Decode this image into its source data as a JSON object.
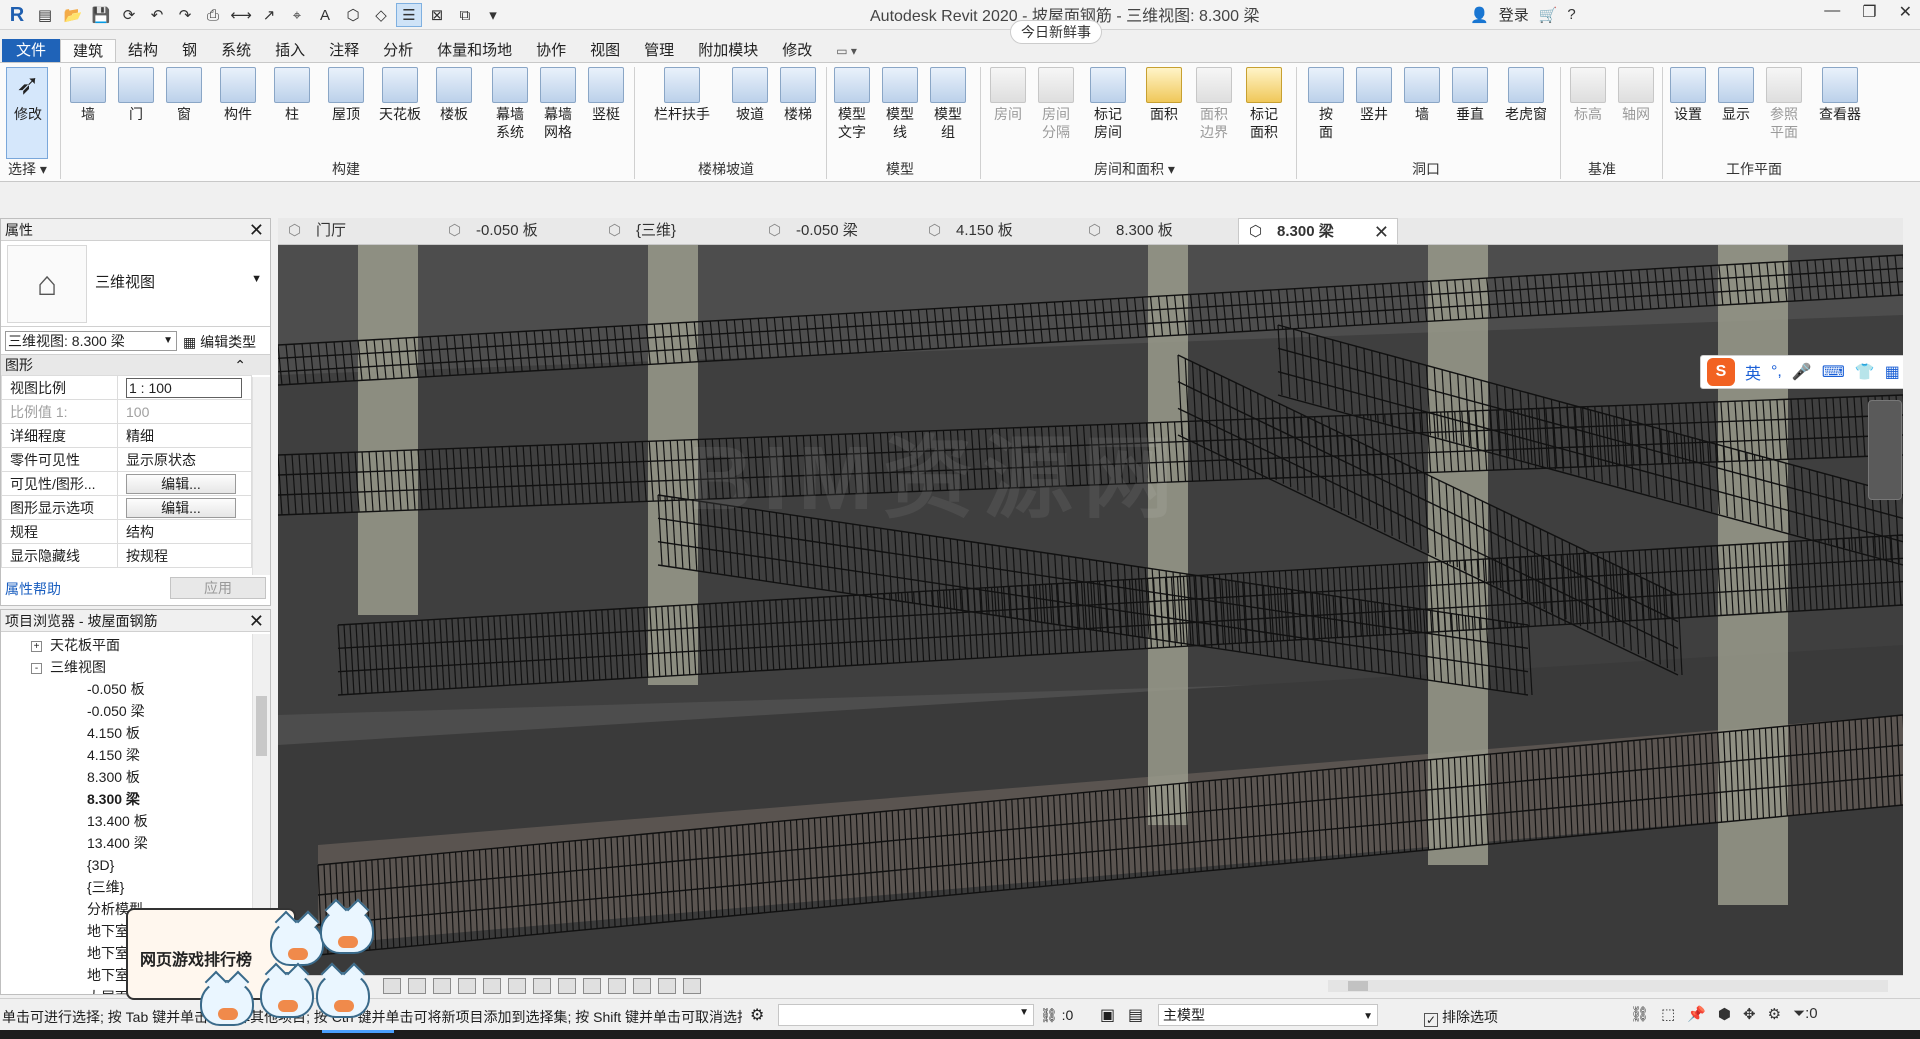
{
  "titlebar": {
    "title": "Autodesk Revit 2020 - 坡屋面钢筋 - 三维视图: 8.300 梁",
    "badge": "今日新鲜事",
    "login": "登录"
  },
  "ribbon_tabs": [
    "文件",
    "建筑",
    "结构",
    "钢",
    "系统",
    "插入",
    "注释",
    "分析",
    "体量和场地",
    "协作",
    "视图",
    "管理",
    "附加模块",
    "修改"
  ],
  "ribbon": {
    "select": {
      "label": "修改",
      "group": "选择"
    },
    "build": {
      "items": [
        "墙",
        "门",
        "窗",
        "构件",
        "柱",
        "屋顶",
        "天花板",
        "楼板",
        "幕墙\n系统",
        "幕墙\n网格",
        "竖梃"
      ],
      "group": "构建"
    },
    "circulation": {
      "items": [
        "栏杆扶手",
        "坡道",
        "楼梯"
      ],
      "group": "楼梯坡道"
    },
    "model": {
      "items": [
        "模型\n文字",
        "模型\n线",
        "模型\n组"
      ],
      "group": "模型"
    },
    "room": {
      "items": [
        "房间",
        "房间\n分隔",
        "标记\n房间",
        "面积",
        "面积\n边界",
        "标记\n面积"
      ],
      "group": "房间和面积"
    },
    "opening": {
      "items": [
        "按\n面",
        "竖井",
        "墙",
        "垂直",
        "老虎窗"
      ],
      "group": "洞口"
    },
    "datum": {
      "items": [
        "标高",
        "轴网"
      ],
      "group": "基准"
    },
    "workplane": {
      "items": [
        "设置",
        "显示",
        "参照\n平面",
        "查看器"
      ],
      "group": "工作平面"
    }
  },
  "properties": {
    "header": "属性",
    "type_name": "三维视图",
    "instance_selector": "三维视图: 8.300 梁",
    "edit_type": "编辑类型",
    "section": "图形",
    "rows": [
      {
        "key": "视图比例",
        "value": "1 : 100"
      },
      {
        "key": "比例值 1:",
        "value": "100"
      },
      {
        "key": "详细程度",
        "value": "精细"
      },
      {
        "key": "零件可见性",
        "value": "显示原状态"
      },
      {
        "key": "可见性/图形...",
        "value": "编辑..."
      },
      {
        "key": "图形显示选项",
        "value": "编辑..."
      },
      {
        "key": "规程",
        "value": "结构"
      },
      {
        "key": "显示隐藏线",
        "value": "按规程"
      }
    ],
    "help": "属性帮助",
    "apply": "应用"
  },
  "browser": {
    "header": "项目浏览器 - 坡屋面钢筋",
    "nodes": [
      {
        "label": "天花板平面",
        "level": 1,
        "toggle": "+"
      },
      {
        "label": "三维视图",
        "level": 1,
        "toggle": "-"
      },
      {
        "label": "-0.050 板",
        "level": 2
      },
      {
        "label": "-0.050 梁",
        "level": 2
      },
      {
        "label": "4.150 板",
        "level": 2
      },
      {
        "label": "4.150 梁",
        "level": 2
      },
      {
        "label": "8.300 板",
        "level": 2
      },
      {
        "label": "8.300 梁",
        "level": 2,
        "bold": true
      },
      {
        "label": "13.400 板",
        "level": 2
      },
      {
        "label": "13.400 梁",
        "level": 2
      },
      {
        "label": "{3D}",
        "level": 2
      },
      {
        "label": "{三维}",
        "level": 2
      },
      {
        "label": "分析模型",
        "level": 2
      },
      {
        "label": "地下室",
        "level": 2
      },
      {
        "label": "地下室",
        "level": 2
      },
      {
        "label": "地下室",
        "level": 2
      },
      {
        "label": "大屋面",
        "level": 2
      }
    ]
  },
  "view_tabs": [
    {
      "label": "门厅"
    },
    {
      "label": "-0.050 板"
    },
    {
      "label": "{三维}"
    },
    {
      "label": "-0.050 梁"
    },
    {
      "label": "4.150 板"
    },
    {
      "label": "8.300 板"
    },
    {
      "label": "8.300 梁",
      "active": true
    }
  ],
  "viewport": {
    "watermark": "BIM资源网",
    "ime": {
      "label": "英"
    }
  },
  "status": {
    "message": "单击可进行选择; 按 Tab 键并单击可选择其他项目; 按 Ctrl 键并单击可将新项目添加到选择集; 按 Shift 键并单击可取消选择。",
    "filter_count": ":0",
    "workset": "主模型",
    "exclude_options": "排除选项",
    "select_count": ":0"
  },
  "widget": {
    "label": "网页游戏排行榜"
  },
  "colors": {
    "accent": "#1f63b8",
    "viewport_bg": "#4d4d4d",
    "concrete": "#9a9b8c"
  }
}
